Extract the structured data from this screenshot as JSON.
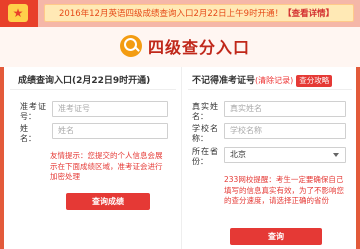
{
  "notice": {
    "text": "2016年12月英语四级成绩查询入口2月22日上午9时开通！",
    "detail_label": "【查看详情】"
  },
  "header": {
    "title": "四级查分入口"
  },
  "left_panel": {
    "title": "成绩查询入口(2月22日9时开通)",
    "ticket_label": "准考证号：",
    "ticket_placeholder": "准考证号",
    "name_label": "姓　名：",
    "name_placeholder": "姓名",
    "tip": "友情提示：您提交的个人信息会展示在下面成绩区域，准考证会进行加密处理",
    "submit_label": "查询成绩"
  },
  "right_panel": {
    "title": "不记得准考证号",
    "clear_label": "(清除记录)",
    "guide_label": "查分攻略",
    "name_label": "真实姓名：",
    "name_placeholder": "真实姓名",
    "school_label": "学校名称：",
    "school_placeholder": "学校名称",
    "province_label": "所在省份：",
    "province_value": "北京",
    "tip": "233网校提醒：考生一定要确保自己填写的信息真实有效，为了不影响您的查分速度，请选择正确的省份",
    "submit_label": "查询"
  },
  "colors": {
    "accent": "#e53935",
    "title": "#c0281a",
    "notice_bg": "#ffe9b5"
  }
}
